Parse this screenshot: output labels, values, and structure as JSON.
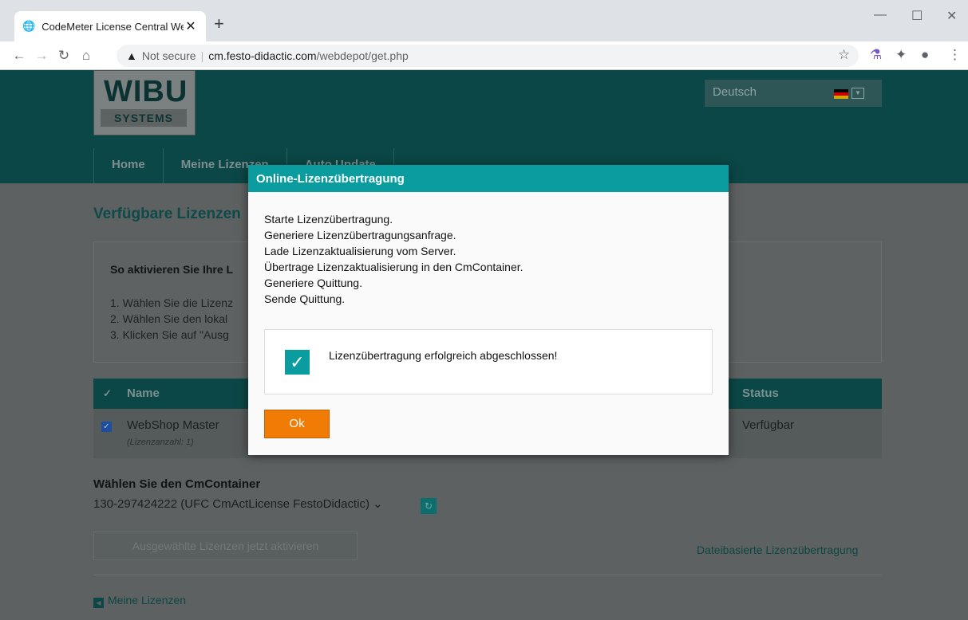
{
  "browser": {
    "tab_title": "CodeMeter License Central WebD",
    "new_tab": "+",
    "url_security": "Not secure",
    "url_host": "cm.festo-didactic.com",
    "url_path": "/webdepot/get.php"
  },
  "header": {
    "logo_top": "WIBU",
    "logo_bottom": "SYSTEMS",
    "language": "Deutsch",
    "nav": [
      "Home",
      "Meine Lizenzen",
      "Auto Update"
    ]
  },
  "page": {
    "title": "Verfügbare Lizenzen",
    "instructions_heading": "So aktivieren Sie Ihre L",
    "steps": [
      "1. Wählen Sie die Lizenz",
      "2. Wählen Sie den lokal",
      "3. Klicken Sie auf \"Ausg"
    ],
    "table": {
      "col_name": "Name",
      "col_status": "Status",
      "row_name": "WebShop Master",
      "row_sub": "(Lizenzanzahl: 1)",
      "row_status": "Verfügbar"
    },
    "container_label": "Wählen Sie den CmContainer",
    "container_value": "130-297424222 (UFC CmActLicense FestoDidactic)",
    "activate_button": "Ausgewählte Lizenzen jetzt aktivieren",
    "file_transfer_link": "Dateibasierte Lizenzübertragung",
    "back_link": "Meine Lizenzen"
  },
  "modal": {
    "title": "Online-Lizenzübertragung",
    "log": [
      "Starte Lizenzübertragung.",
      "Generiere Lizenzübertragungsanfrage.",
      "Lade Lizenzaktualisierung vom Server.",
      "Übertrage Lizenzaktualisierung in den CmContainer.",
      "Generiere Quittung.",
      "Sende Quittung."
    ],
    "success_message": "Lizenzübertragung erfolgreich abgeschlossen!",
    "ok_button": "Ok"
  },
  "colors": {
    "accent": "#0a9c9f",
    "ok": "#f07b05",
    "header": "#0b4746"
  }
}
